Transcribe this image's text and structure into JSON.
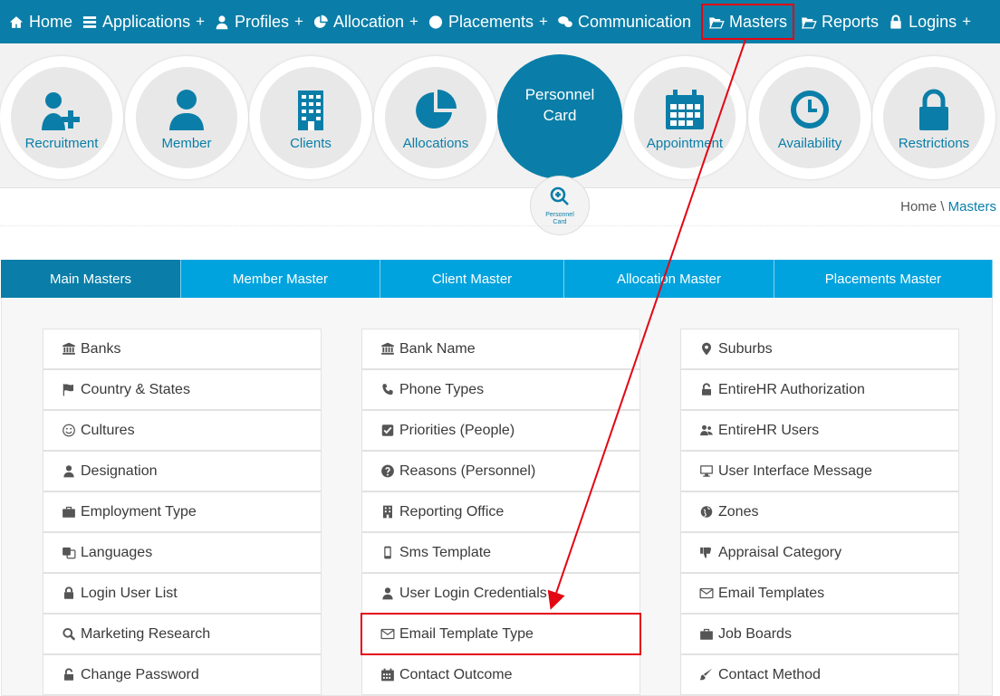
{
  "nav": {
    "items": [
      {
        "label": "Home",
        "icon": "home-icon",
        "plus": ""
      },
      {
        "label": "Applications",
        "icon": "list-icon",
        "plus": "+"
      },
      {
        "label": "Profiles",
        "icon": "user-icon",
        "plus": "+"
      },
      {
        "label": "Allocation",
        "icon": "pie-chart-icon",
        "plus": "+"
      },
      {
        "label": "Placements",
        "icon": "globe-icon",
        "plus": "+"
      },
      {
        "label": "Communication",
        "icon": "chat-icon",
        "plus": ""
      },
      {
        "label": "Masters",
        "icon": "folder-open-icon",
        "plus": ""
      },
      {
        "label": "Reports",
        "icon": "folder-open-icon",
        "plus": ""
      },
      {
        "label": "Logins",
        "icon": "lock-icon",
        "plus": "+"
      }
    ],
    "highlighted": "Masters"
  },
  "icon_strip": {
    "items": [
      "Recruitment",
      "Member",
      "Clients",
      "Allocations",
      "Appointment",
      "Availability",
      "Restrictions"
    ],
    "personnel_card": {
      "title_line1": "Personnel",
      "title_line2": "Card",
      "badge_line1": "Personnel",
      "badge_line2": "Card"
    }
  },
  "breadcrumb": {
    "home": "Home",
    "separator": "\\",
    "current": "Masters"
  },
  "tabs": [
    {
      "label": "Main Masters"
    },
    {
      "label": "Member Master"
    },
    {
      "label": "Client Master"
    },
    {
      "label": "Allocation Master"
    },
    {
      "label": "Placements Master"
    }
  ],
  "masters": {
    "col1": [
      {
        "label": "Banks",
        "icon": "bank-icon"
      },
      {
        "label": "Country & States",
        "icon": "flag-icon"
      },
      {
        "label": "Cultures",
        "icon": "smile-icon"
      },
      {
        "label": "Designation",
        "icon": "user-icon"
      },
      {
        "label": "Employment Type",
        "icon": "briefcase-icon"
      },
      {
        "label": "Languages",
        "icon": "language-icon"
      },
      {
        "label": "Login User List",
        "icon": "lock-icon"
      },
      {
        "label": "Marketing Research",
        "icon": "search-icon"
      },
      {
        "label": "Change Password",
        "icon": "unlock-icon"
      }
    ],
    "col2": [
      {
        "label": "Bank Name",
        "icon": "bank-icon"
      },
      {
        "label": "Phone Types",
        "icon": "phone-icon"
      },
      {
        "label": "Priorities (People)",
        "icon": "check-square-icon"
      },
      {
        "label": "Reasons (Personnel)",
        "icon": "question-circle-icon"
      },
      {
        "label": "Reporting Office",
        "icon": "building-icon"
      },
      {
        "label": "Sms Template",
        "icon": "mobile-icon"
      },
      {
        "label": "User Login Credentials",
        "icon": "user-icon"
      },
      {
        "label": "Email Template Type",
        "icon": "envelope-icon"
      },
      {
        "label": "Contact Outcome",
        "icon": "calendar-icon"
      }
    ],
    "col3": [
      {
        "label": "Suburbs",
        "icon": "map-marker-icon"
      },
      {
        "label": "EntireHR Authorization",
        "icon": "unlock-icon"
      },
      {
        "label": "EntireHR Users",
        "icon": "users-icon"
      },
      {
        "label": "User Interface Message",
        "icon": "desktop-icon"
      },
      {
        "label": "Zones",
        "icon": "globe-icon"
      },
      {
        "label": "Appraisal Category",
        "icon": "thumbs-down-icon"
      },
      {
        "label": "Email Templates",
        "icon": "envelope-icon"
      },
      {
        "label": "Job Boards",
        "icon": "briefcase-icon"
      },
      {
        "label": "Contact Method",
        "icon": "brush-icon"
      }
    ],
    "highlighted": "Email Template Type"
  },
  "annotation": {
    "color": "#e30613"
  },
  "colors": {
    "primary": "#0a7ea8",
    "tab": "#00a3dd",
    "highlight": "#e30613"
  }
}
